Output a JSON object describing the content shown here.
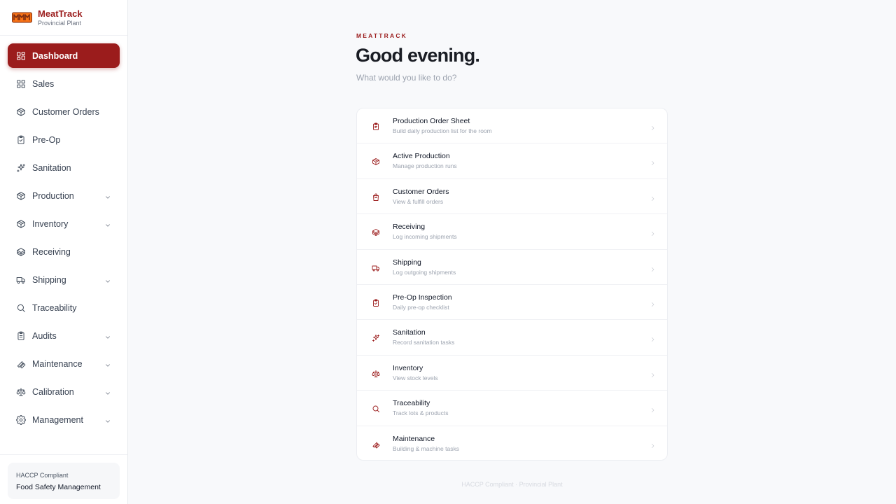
{
  "brand": {
    "name": "MeatTrack",
    "subtitle": "Provincial Plant",
    "accent_color": "#9b1c1c",
    "logo_icon": "meattrack-logo-icon"
  },
  "sidebar": {
    "items": [
      {
        "label": "Dashboard",
        "icon": "dashboard-icon",
        "active": true,
        "expandable": false
      },
      {
        "label": "Sales",
        "icon": "grid-icon",
        "active": false,
        "expandable": false
      },
      {
        "label": "Customer Orders",
        "icon": "box-icon",
        "active": false,
        "expandable": false
      },
      {
        "label": "Pre-Op",
        "icon": "clipboard-check-icon",
        "active": false,
        "expandable": false
      },
      {
        "label": "Sanitation",
        "icon": "sparkles-icon",
        "active": false,
        "expandable": false
      },
      {
        "label": "Production",
        "icon": "box-icon",
        "active": false,
        "expandable": true
      },
      {
        "label": "Inventory",
        "icon": "box-icon",
        "active": false,
        "expandable": true
      },
      {
        "label": "Receiving",
        "icon": "package-icon",
        "active": false,
        "expandable": false
      },
      {
        "label": "Shipping",
        "icon": "truck-icon",
        "active": false,
        "expandable": true
      },
      {
        "label": "Traceability",
        "icon": "search-icon",
        "active": false,
        "expandable": false
      },
      {
        "label": "Audits",
        "icon": "clipboard-icon",
        "active": false,
        "expandable": true
      },
      {
        "label": "Maintenance",
        "icon": "wrench-icon",
        "active": false,
        "expandable": true
      },
      {
        "label": "Calibration",
        "icon": "scale-icon",
        "active": false,
        "expandable": true
      },
      {
        "label": "Management",
        "icon": "gear-icon",
        "active": false,
        "expandable": true
      }
    ],
    "footer": {
      "small": "HACCP Compliant",
      "big": "Food Safety Management"
    }
  },
  "main": {
    "eyebrow": "MEATTRACK",
    "greeting": "Good evening.",
    "subtitle": "What would you like to do?",
    "actions": [
      {
        "title": "Production Order Sheet",
        "description": "Build daily production list for the room",
        "icon": "clipboard-list-icon"
      },
      {
        "title": "Active Production",
        "description": "Manage production runs",
        "icon": "box-icon"
      },
      {
        "title": "Customer Orders",
        "description": "View & fulfill orders",
        "icon": "shopping-bag-icon"
      },
      {
        "title": "Receiving",
        "description": "Log incoming shipments",
        "icon": "package-icon"
      },
      {
        "title": "Shipping",
        "description": "Log outgoing shipments",
        "icon": "truck-icon"
      },
      {
        "title": "Pre-Op Inspection",
        "description": "Daily pre-op checklist",
        "icon": "clipboard-check-icon"
      },
      {
        "title": "Sanitation",
        "description": "Record sanitation tasks",
        "icon": "sparkles-icon"
      },
      {
        "title": "Inventory",
        "description": "View stock levels",
        "icon": "scale-icon"
      },
      {
        "title": "Traceability",
        "description": "Track lots & products",
        "icon": "search-icon"
      },
      {
        "title": "Maintenance",
        "description": "Building & machine tasks",
        "icon": "wrench-icon"
      }
    ],
    "footer": "HACCP Compliant · Provincial Plant"
  }
}
